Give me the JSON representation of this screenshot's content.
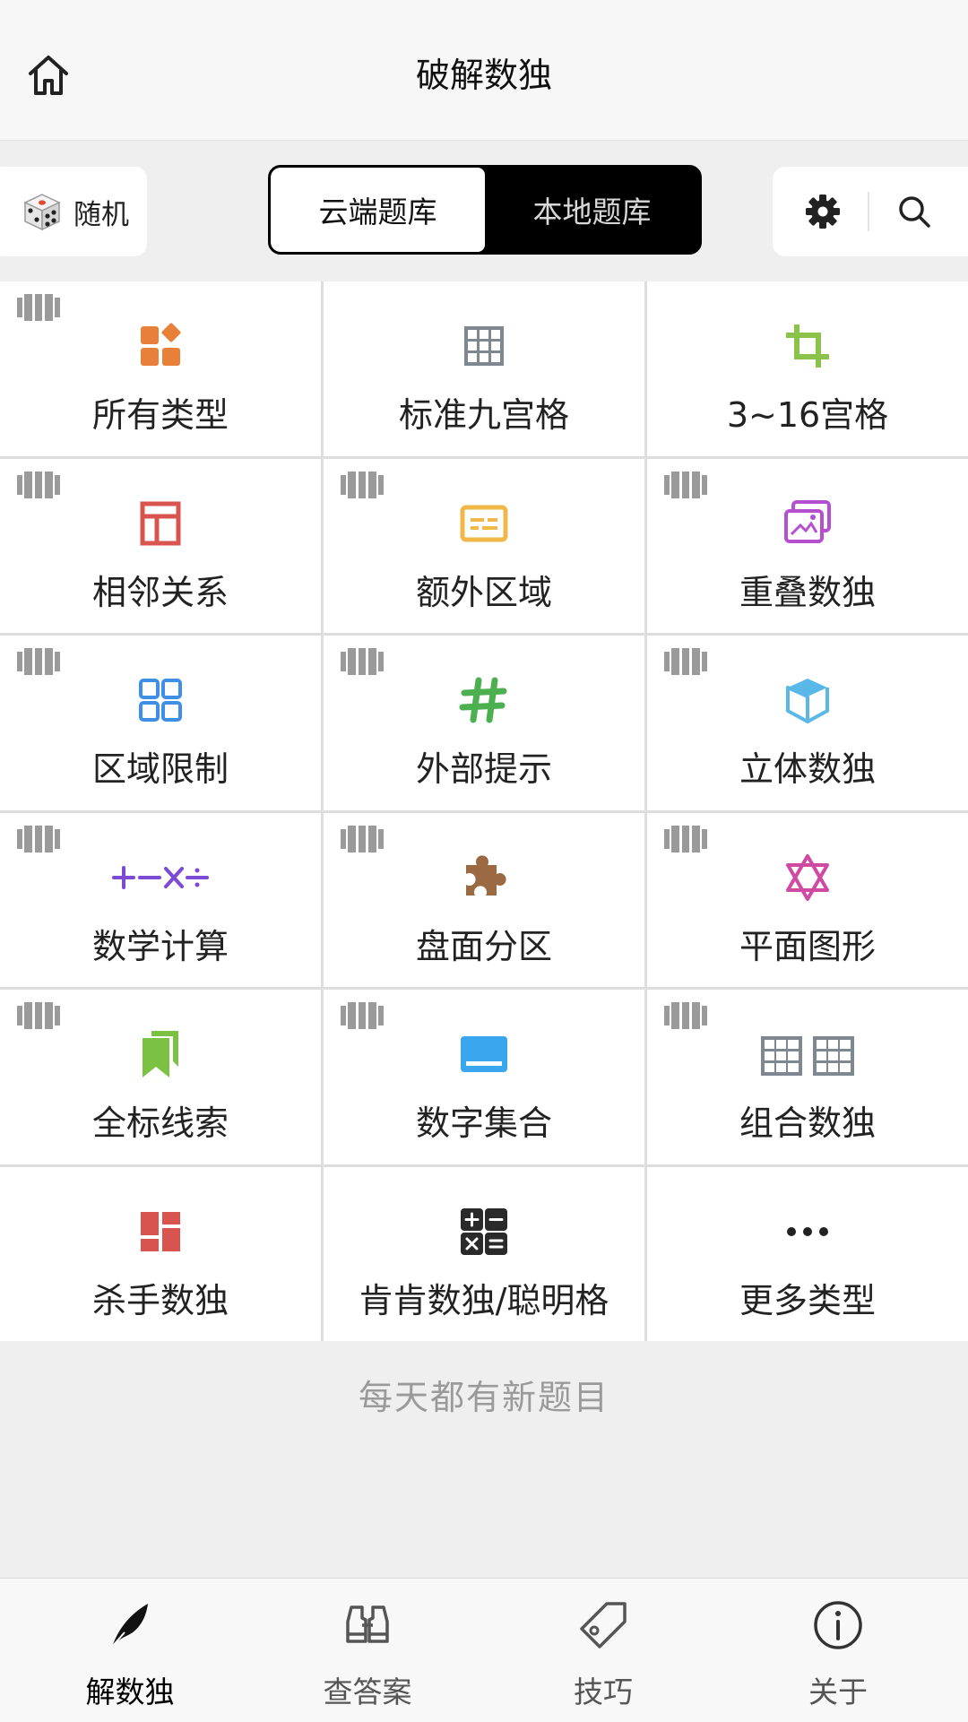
{
  "header": {
    "title": "破解数独"
  },
  "toolbar": {
    "random_label": "随机",
    "segments": [
      {
        "label": "云端题库",
        "selected": true
      },
      {
        "label": "本地题库",
        "selected": false
      }
    ]
  },
  "categories": [
    {
      "label": "所有类型",
      "icon": "apps-icon"
    },
    {
      "label": "标准九宫格",
      "icon": "grid-icon"
    },
    {
      "label": "3~16宫格",
      "icon": "crop-icon"
    },
    {
      "label": "相邻关系",
      "icon": "layout-icon"
    },
    {
      "label": "额外区域",
      "icon": "subtitles-icon"
    },
    {
      "label": "重叠数独",
      "icon": "photos-icon"
    },
    {
      "label": "区域限制",
      "icon": "four-squares-icon"
    },
    {
      "label": "外部提示",
      "icon": "hashtag-icon"
    },
    {
      "label": "立体数独",
      "icon": "cube-icon"
    },
    {
      "label": "数学计算",
      "icon": "math-operators-icon"
    },
    {
      "label": "盘面分区",
      "icon": "puzzle-piece-icon"
    },
    {
      "label": "平面图形",
      "icon": "star-of-david-icon"
    },
    {
      "label": "全标线索",
      "icon": "bookmarks-icon"
    },
    {
      "label": "数字集合",
      "icon": "laptop-icon"
    },
    {
      "label": "组合数独",
      "icon": "double-grid-icon"
    },
    {
      "label": "杀手数独",
      "icon": "dashboard-icon"
    },
    {
      "label": "肯肯数独/聪明格",
      "icon": "calculator-icon"
    },
    {
      "label": "更多类型",
      "icon": "more-dots-icon"
    }
  ],
  "footer_note": "每天都有新题目",
  "bottom_nav": [
    {
      "label": "解数独",
      "icon": "quill-icon",
      "active": true
    },
    {
      "label": "查答案",
      "icon": "binoculars-icon",
      "active": false
    },
    {
      "label": "技巧",
      "icon": "tag-icon",
      "active": false
    },
    {
      "label": "关于",
      "icon": "info-icon",
      "active": false
    }
  ],
  "colors": {
    "orange": "#e8803a",
    "gray": "#7f8890",
    "green": "#8bc34a",
    "red": "#d9534f",
    "yellow": "#f0b84a",
    "purple": "#b44fcf",
    "blue": "#3f8fe6",
    "bright_green": "#4caf50",
    "light_blue": "#5ab8e8",
    "violet": "#7b4bd6",
    "brown": "#9b6a43",
    "pink": "#d04aa3",
    "leaf_green": "#7cc242",
    "sky_blue": "#3aa6ee"
  }
}
